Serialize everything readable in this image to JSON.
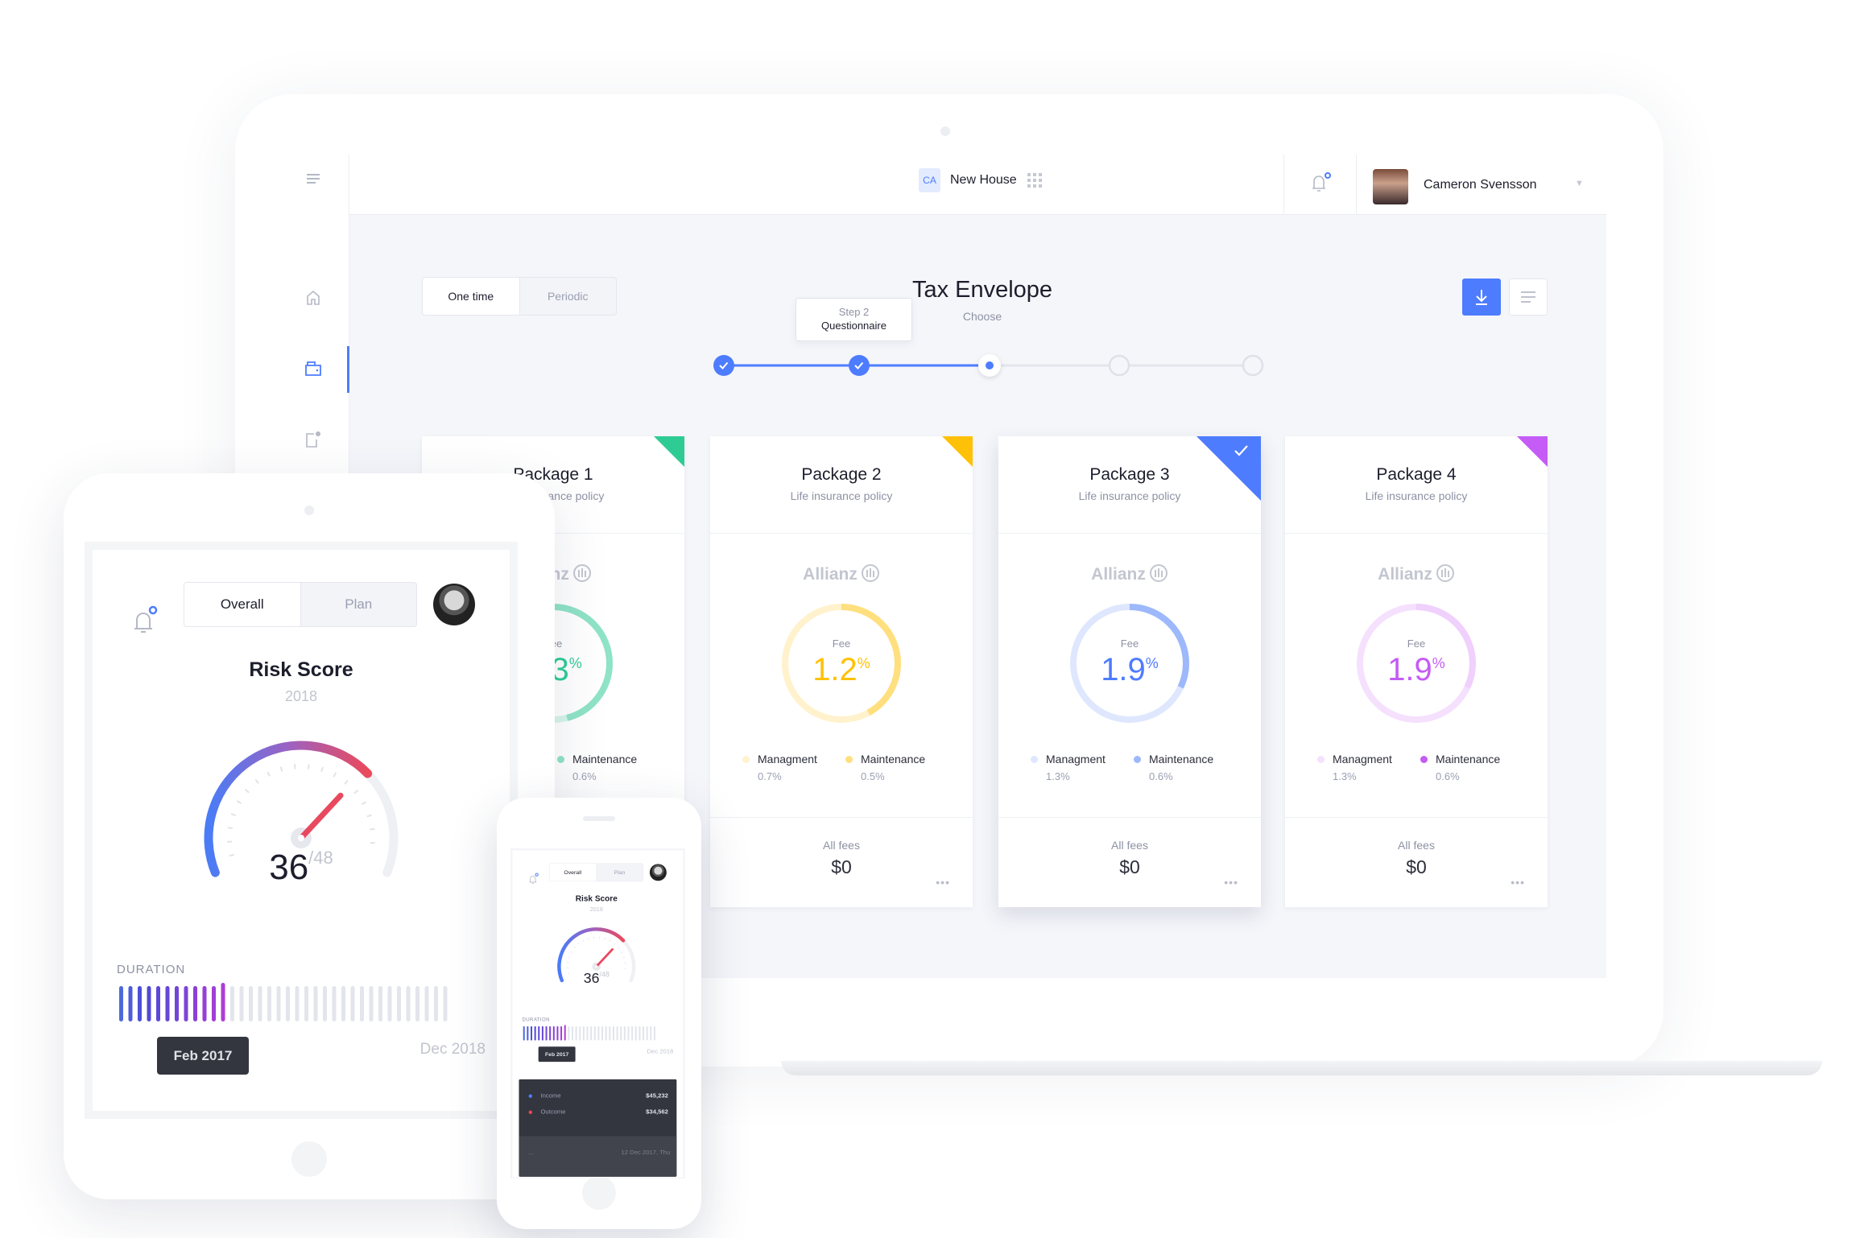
{
  "header": {
    "project_badge": "CA",
    "project_name": "New House",
    "apps_icon": "grid-icon",
    "notification_icon": "bell-icon",
    "user_name": "Cameron Svensson"
  },
  "sidebar": {
    "items": [
      {
        "icon": "menu-icon"
      },
      {
        "icon": "home-icon"
      },
      {
        "icon": "wallet-icon",
        "active": true
      },
      {
        "icon": "document-notification-icon"
      }
    ]
  },
  "main": {
    "frequency_tabs": [
      {
        "label": "One time",
        "active": true
      },
      {
        "label": "Periodic",
        "active": false
      }
    ],
    "title": "Tax Envelope",
    "subtitle": "Choose",
    "stepper": {
      "tooltip_step": "Step 2",
      "tooltip_label": "Questionnaire",
      "steps": [
        "done",
        "done",
        "current",
        "pending",
        "pending"
      ]
    },
    "accent_color": "#4d7cfe",
    "packages": [
      {
        "title": "Package 1",
        "subtitle": "Life insurance policy",
        "provider": "Allianz",
        "fee_label": "Fee",
        "fee": "1.3",
        "unit": "%",
        "color": "#2ecc94",
        "light": "#d6f5ea",
        "arc": "#8fe3c6",
        "maintenance_share": 0.46,
        "legend": {
          "maintenance": {
            "label": "Maintenance",
            "value": "0.6%"
          }
        },
        "selected": false
      },
      {
        "title": "Package 2",
        "subtitle": "Life insurance policy",
        "provider": "Allianz",
        "fee_label": "Fee",
        "fee": "1.2",
        "unit": "%",
        "color": "#ffc107",
        "light": "#fff2cc",
        "arc": "#ffdf7e",
        "maintenance_share": 0.42,
        "legend": {
          "management": {
            "label": "Managment",
            "value": "0.7%"
          },
          "maintenance": {
            "label": "Maintenance",
            "value": "0.5%"
          }
        },
        "all_fees_label": "All fees",
        "all_fees": "$0",
        "selected": false
      },
      {
        "title": "Package 3",
        "subtitle": "Life insurance policy",
        "provider": "Allianz",
        "fee_label": "Fee",
        "fee": "1.9",
        "unit": "%",
        "color": "#4d7cfe",
        "light": "#dee7fe",
        "arc": "#9db9fb",
        "maintenance_share": 0.32,
        "legend": {
          "management": {
            "label": "Managment",
            "value": "1.3%"
          },
          "maintenance": {
            "label": "Maintenance",
            "value": "0.6%"
          }
        },
        "all_fees_label": "All fees",
        "all_fees": "$0",
        "selected": true
      },
      {
        "title": "Package 4",
        "subtitle": "Life insurance policy",
        "provider": "Allianz",
        "fee_label": "Fee",
        "fee": "1.9",
        "unit": "%",
        "color": "#c45cf5",
        "light": "#f5e0fd",
        "arc": "#f0d0fc",
        "maintenance_share": 0.32,
        "legend": {
          "management": {
            "label": "Managment",
            "value": "1.3%"
          },
          "maintenance": {
            "label": "Maintenance",
            "value": "0.6%"
          }
        },
        "all_fees_label": "All fees",
        "all_fees": "$0",
        "selected": false
      }
    ]
  },
  "risk_app": {
    "tabs": [
      {
        "label": "Overall",
        "active": true
      },
      {
        "label": "Plan",
        "active": false
      }
    ],
    "title": "Risk Score",
    "year": "2018",
    "score": "36",
    "max": "/48",
    "score_value": 36,
    "score_max": 48,
    "duration_label": "DURATION",
    "duration_total_bars": 36,
    "duration_active_bars": 12,
    "duration_tooltip": "Feb 2017",
    "duration_end": "Dec 2018"
  },
  "phone_extra": {
    "rows": [
      {
        "label": "Income",
        "value": "$45,232",
        "color": "#4d7cfe"
      },
      {
        "label": "Outcome",
        "value": "$34,562",
        "color": "#f0454f"
      }
    ],
    "footer_left": "...",
    "footer_date": "12 Dec 2017, Thu"
  }
}
